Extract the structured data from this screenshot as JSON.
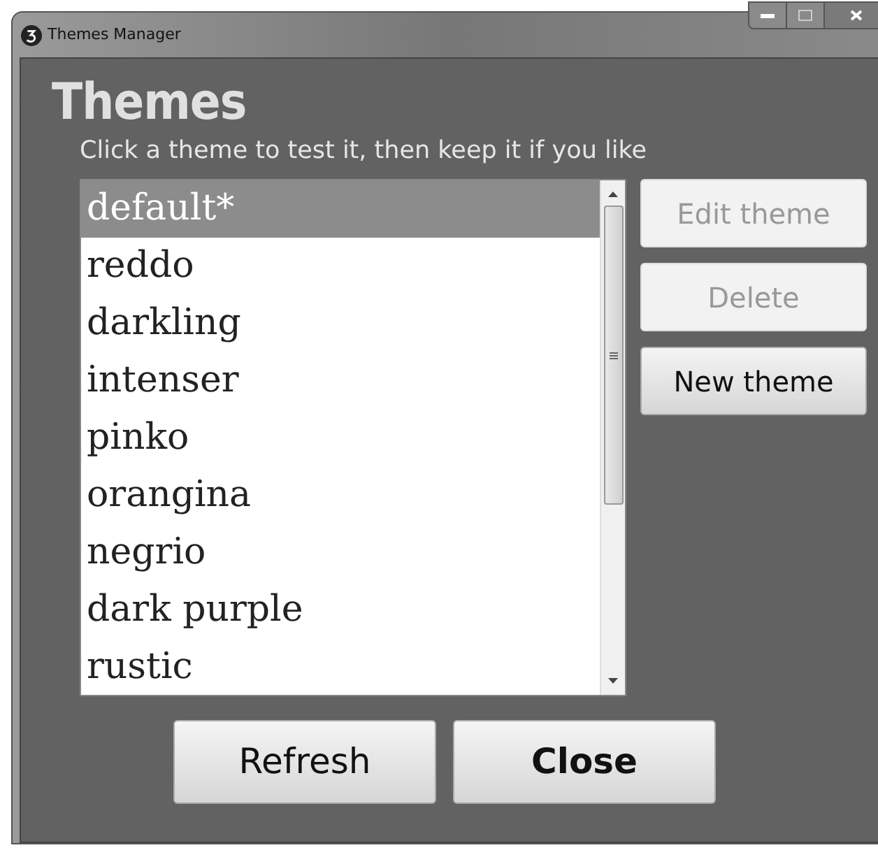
{
  "window": {
    "title": "Themes Manager"
  },
  "heading": "Themes",
  "subtitle": "Click a theme to test it, then keep it if you like",
  "themes": [
    {
      "name": "default*",
      "selected": true
    },
    {
      "name": "reddo",
      "selected": false
    },
    {
      "name": "darkling",
      "selected": false
    },
    {
      "name": "intenser",
      "selected": false
    },
    {
      "name": "pinko",
      "selected": false
    },
    {
      "name": "orangina",
      "selected": false
    },
    {
      "name": "negrio",
      "selected": false
    },
    {
      "name": "dark purple",
      "selected": false
    },
    {
      "name": "rustic",
      "selected": false
    }
  ],
  "side_buttons": [
    {
      "label": "Edit theme",
      "disabled": true
    },
    {
      "label": "Delete",
      "disabled": true
    },
    {
      "label": "New theme",
      "disabled": false
    }
  ],
  "bottom_buttons": [
    {
      "label": "Refresh",
      "default": false
    },
    {
      "label": "Close",
      "default": true
    }
  ]
}
